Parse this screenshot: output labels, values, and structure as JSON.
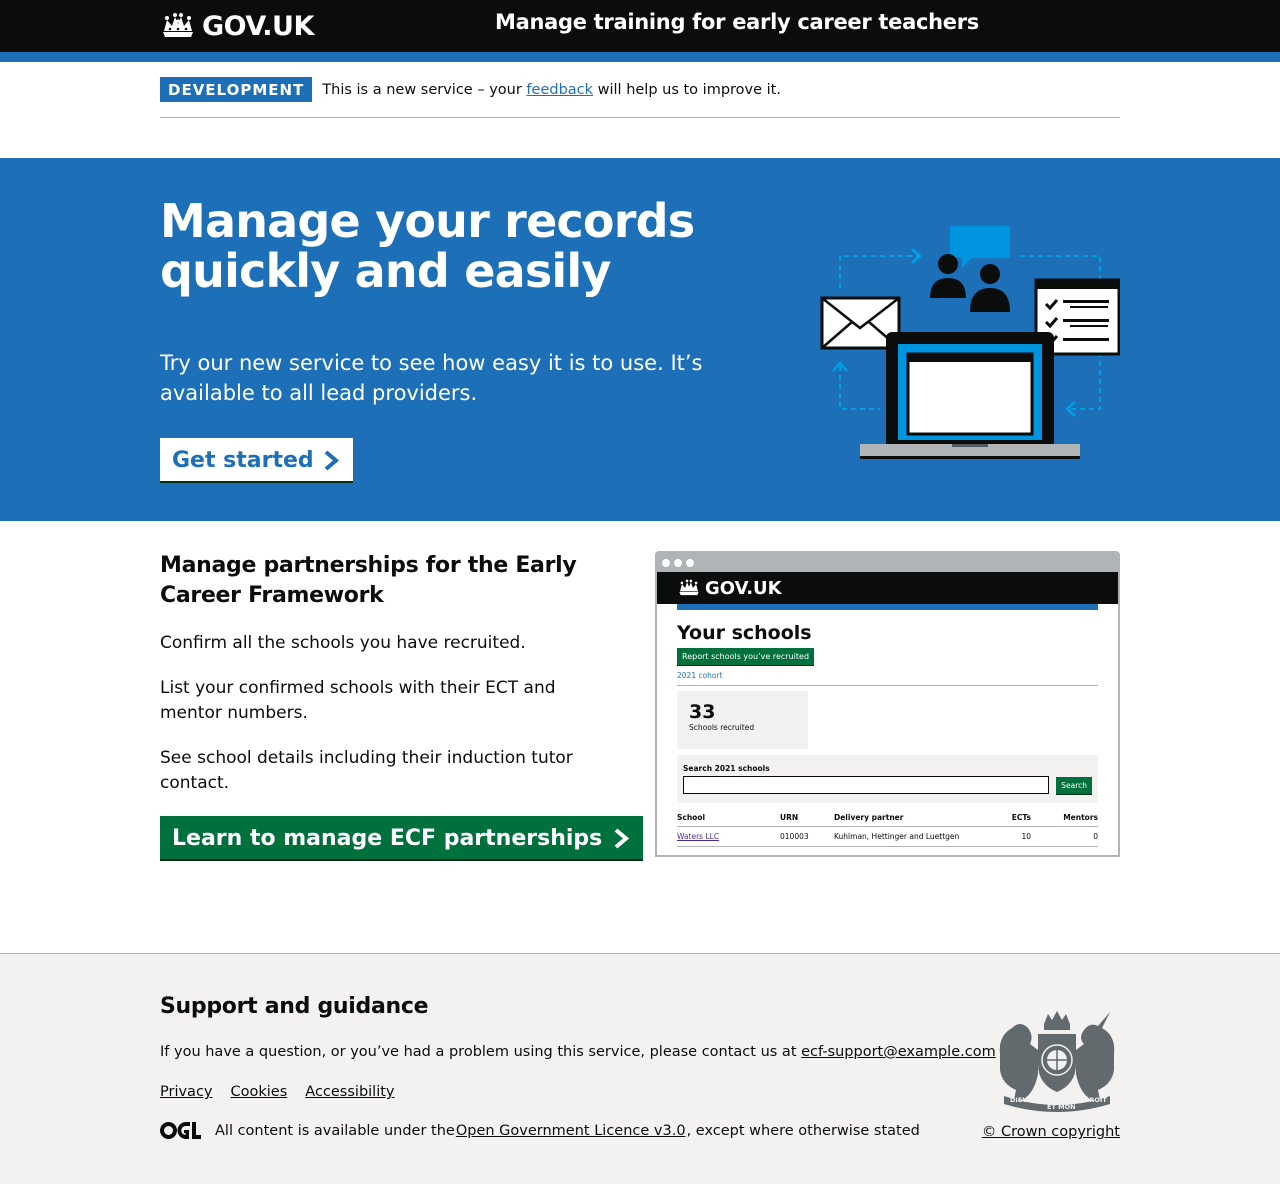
{
  "header": {
    "logo_text": "GOV.UK",
    "service_name": "Manage training for early career teachers"
  },
  "phase_banner": {
    "tag": "DEVELOPMENT",
    "text_before": "This is a new service – your ",
    "link": "feedback",
    "text_after": " will help us to improve it."
  },
  "hero": {
    "title": "Manage your records quickly and easily",
    "description": "Try our new service to see how easy it is to use. It’s available to all lead providers.",
    "button_label": "Get started"
  },
  "partnerships": {
    "title": "Manage partnerships for the Early Career Framework",
    "paragraphs": [
      "Confirm all the schools you have recruited.",
      "List your confirmed schools with their ECT and mentor numbers.",
      "See school details including their induction tutor contact."
    ],
    "button_label": "Learn to manage ECF partnerships"
  },
  "preview": {
    "logo_text": "GOV.UK",
    "title": "Your schools",
    "report_button": "Report schools you’ve recruited",
    "cohort_link": "2021 cohort",
    "stat_number": "33",
    "stat_label": "Schools recruited",
    "search_label": "Search 2021 schools",
    "search_button": "Search",
    "table": {
      "headers": [
        "School",
        "URN",
        "Delivery partner",
        "ECTs",
        "Mentors"
      ],
      "rows": [
        [
          "Waters LLC",
          "010003",
          "Kuhlman, Hettinger and Luettgen",
          "10",
          "0"
        ]
      ]
    }
  },
  "footer": {
    "title": "Support and guidance",
    "contact_text": "If you have a question, or you’ve had a problem using this service, please contact us at ",
    "contact_email": "ecf-support@example.com",
    "links": [
      "Privacy",
      "Cookies",
      "Accessibility"
    ],
    "licence_before": "All content is available under the ",
    "licence_link": "Open Government Licence v3.0",
    "licence_after": ", except where otherwise stated",
    "crown_copyright": "© Crown copyright",
    "crest_motto_left": "DIEU",
    "crest_motto_right": "DROIT",
    "crest_motto_bottom": "ET MON"
  },
  "colors": {
    "brand_blue": "#1d70b8",
    "header_black": "#0b0c0c",
    "button_green": "#00703c",
    "footer_grey": "#f3f2f1"
  },
  "icons": {
    "logo": "crown-icon",
    "button_arrow": "chevron-right-icon",
    "footer_licence": "ogl-logo",
    "footer_crest": "royal-coat-of-arms"
  }
}
